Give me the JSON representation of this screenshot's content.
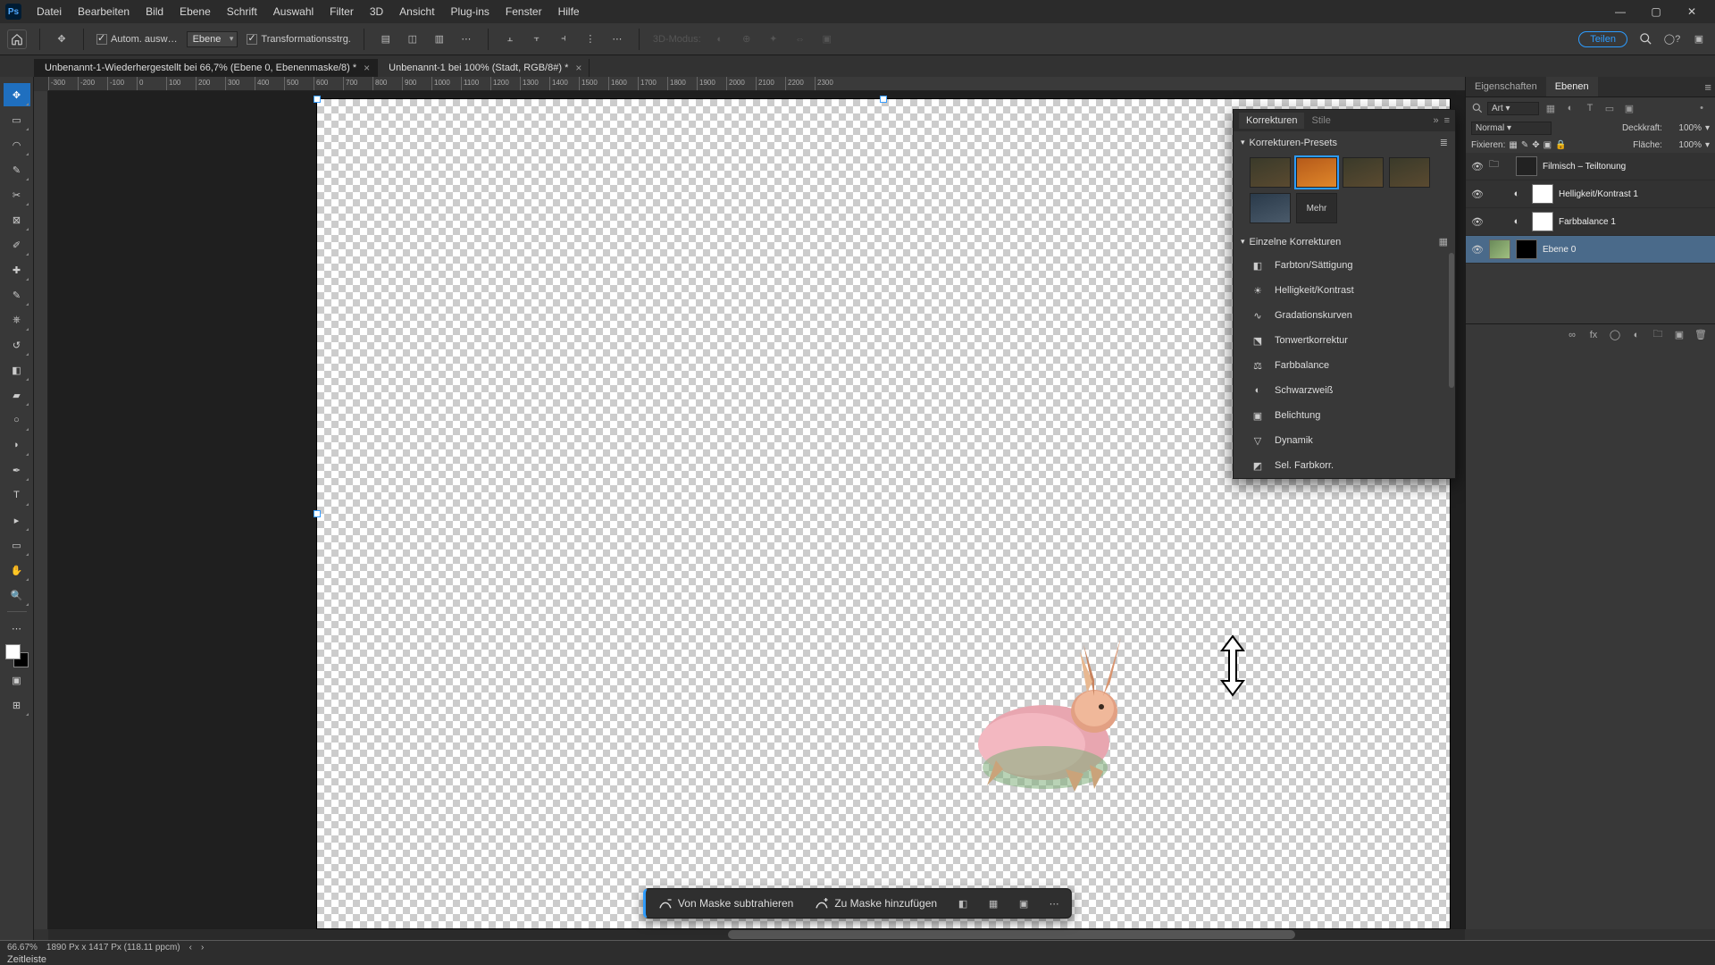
{
  "menubar": [
    "Datei",
    "Bearbeiten",
    "Bild",
    "Ebene",
    "Schrift",
    "Auswahl",
    "Filter",
    "3D",
    "Ansicht",
    "Plug-ins",
    "Fenster",
    "Hilfe"
  ],
  "optionbar": {
    "auto_select": "Autom. ausw…",
    "target": "Ebene",
    "transform": "Transformationsstrg.",
    "mode3d": "3D-Modus:",
    "share": "Teilen"
  },
  "tabs": [
    {
      "label": "Unbenannt-1-Wiederhergestellt bei 66,7% (Ebene 0, Ebenenmaske/8) *",
      "active": true
    },
    {
      "label": "Unbenannt-1 bei 100% (Stadt, RGB/8#) *",
      "active": false
    }
  ],
  "ruler_ticks": [
    "-300",
    "-200",
    "-100",
    "0",
    "100",
    "200",
    "300",
    "400",
    "500",
    "600",
    "700",
    "800",
    "900",
    "1000",
    "1100",
    "1200",
    "1300",
    "1400",
    "1500",
    "1600",
    "1700",
    "1800",
    "1900",
    "2000",
    "2100",
    "2200",
    "2300"
  ],
  "mask_bar": {
    "subtract": "Von Maske subtrahieren",
    "add": "Zu Maske hinzufügen"
  },
  "adjustments": {
    "tab1": "Korrekturen",
    "tab2": "Stile",
    "presets_title": "Korrekturen-Presets",
    "more": "Mehr",
    "single_title": "Einzelne Korrekturen",
    "items": [
      "Farbton/Sättigung",
      "Helligkeit/Kontrast",
      "Gradationskurven",
      "Tonwertkorrektur",
      "Farbbalance",
      "Schwarzweiß",
      "Belichtung",
      "Dynamik",
      "Sel. Farbkorr."
    ]
  },
  "layers_panel": {
    "tab1": "Eigenschaften",
    "tab2": "Ebenen",
    "filter_kind": "Art",
    "blend": "Normal",
    "opacity_label": "Deckkraft:",
    "opacity_val": "100%",
    "lock_label": "Fixieren:",
    "fill_label": "Fläche:",
    "fill_val": "100%",
    "layers": [
      {
        "name": "Filmisch – Teiltonung",
        "type": "group",
        "sel": false
      },
      {
        "name": "Helligkeit/Kontrast 1",
        "type": "adj",
        "sel": false
      },
      {
        "name": "Farbbalance 1",
        "type": "adj",
        "sel": false
      },
      {
        "name": "Ebene 0",
        "type": "pixel",
        "sel": true
      }
    ]
  },
  "status": {
    "zoom": "66.67%",
    "info": "1890 Px x 1417 Px (118.11 ppcm)",
    "timeline": "Zeitleiste"
  }
}
